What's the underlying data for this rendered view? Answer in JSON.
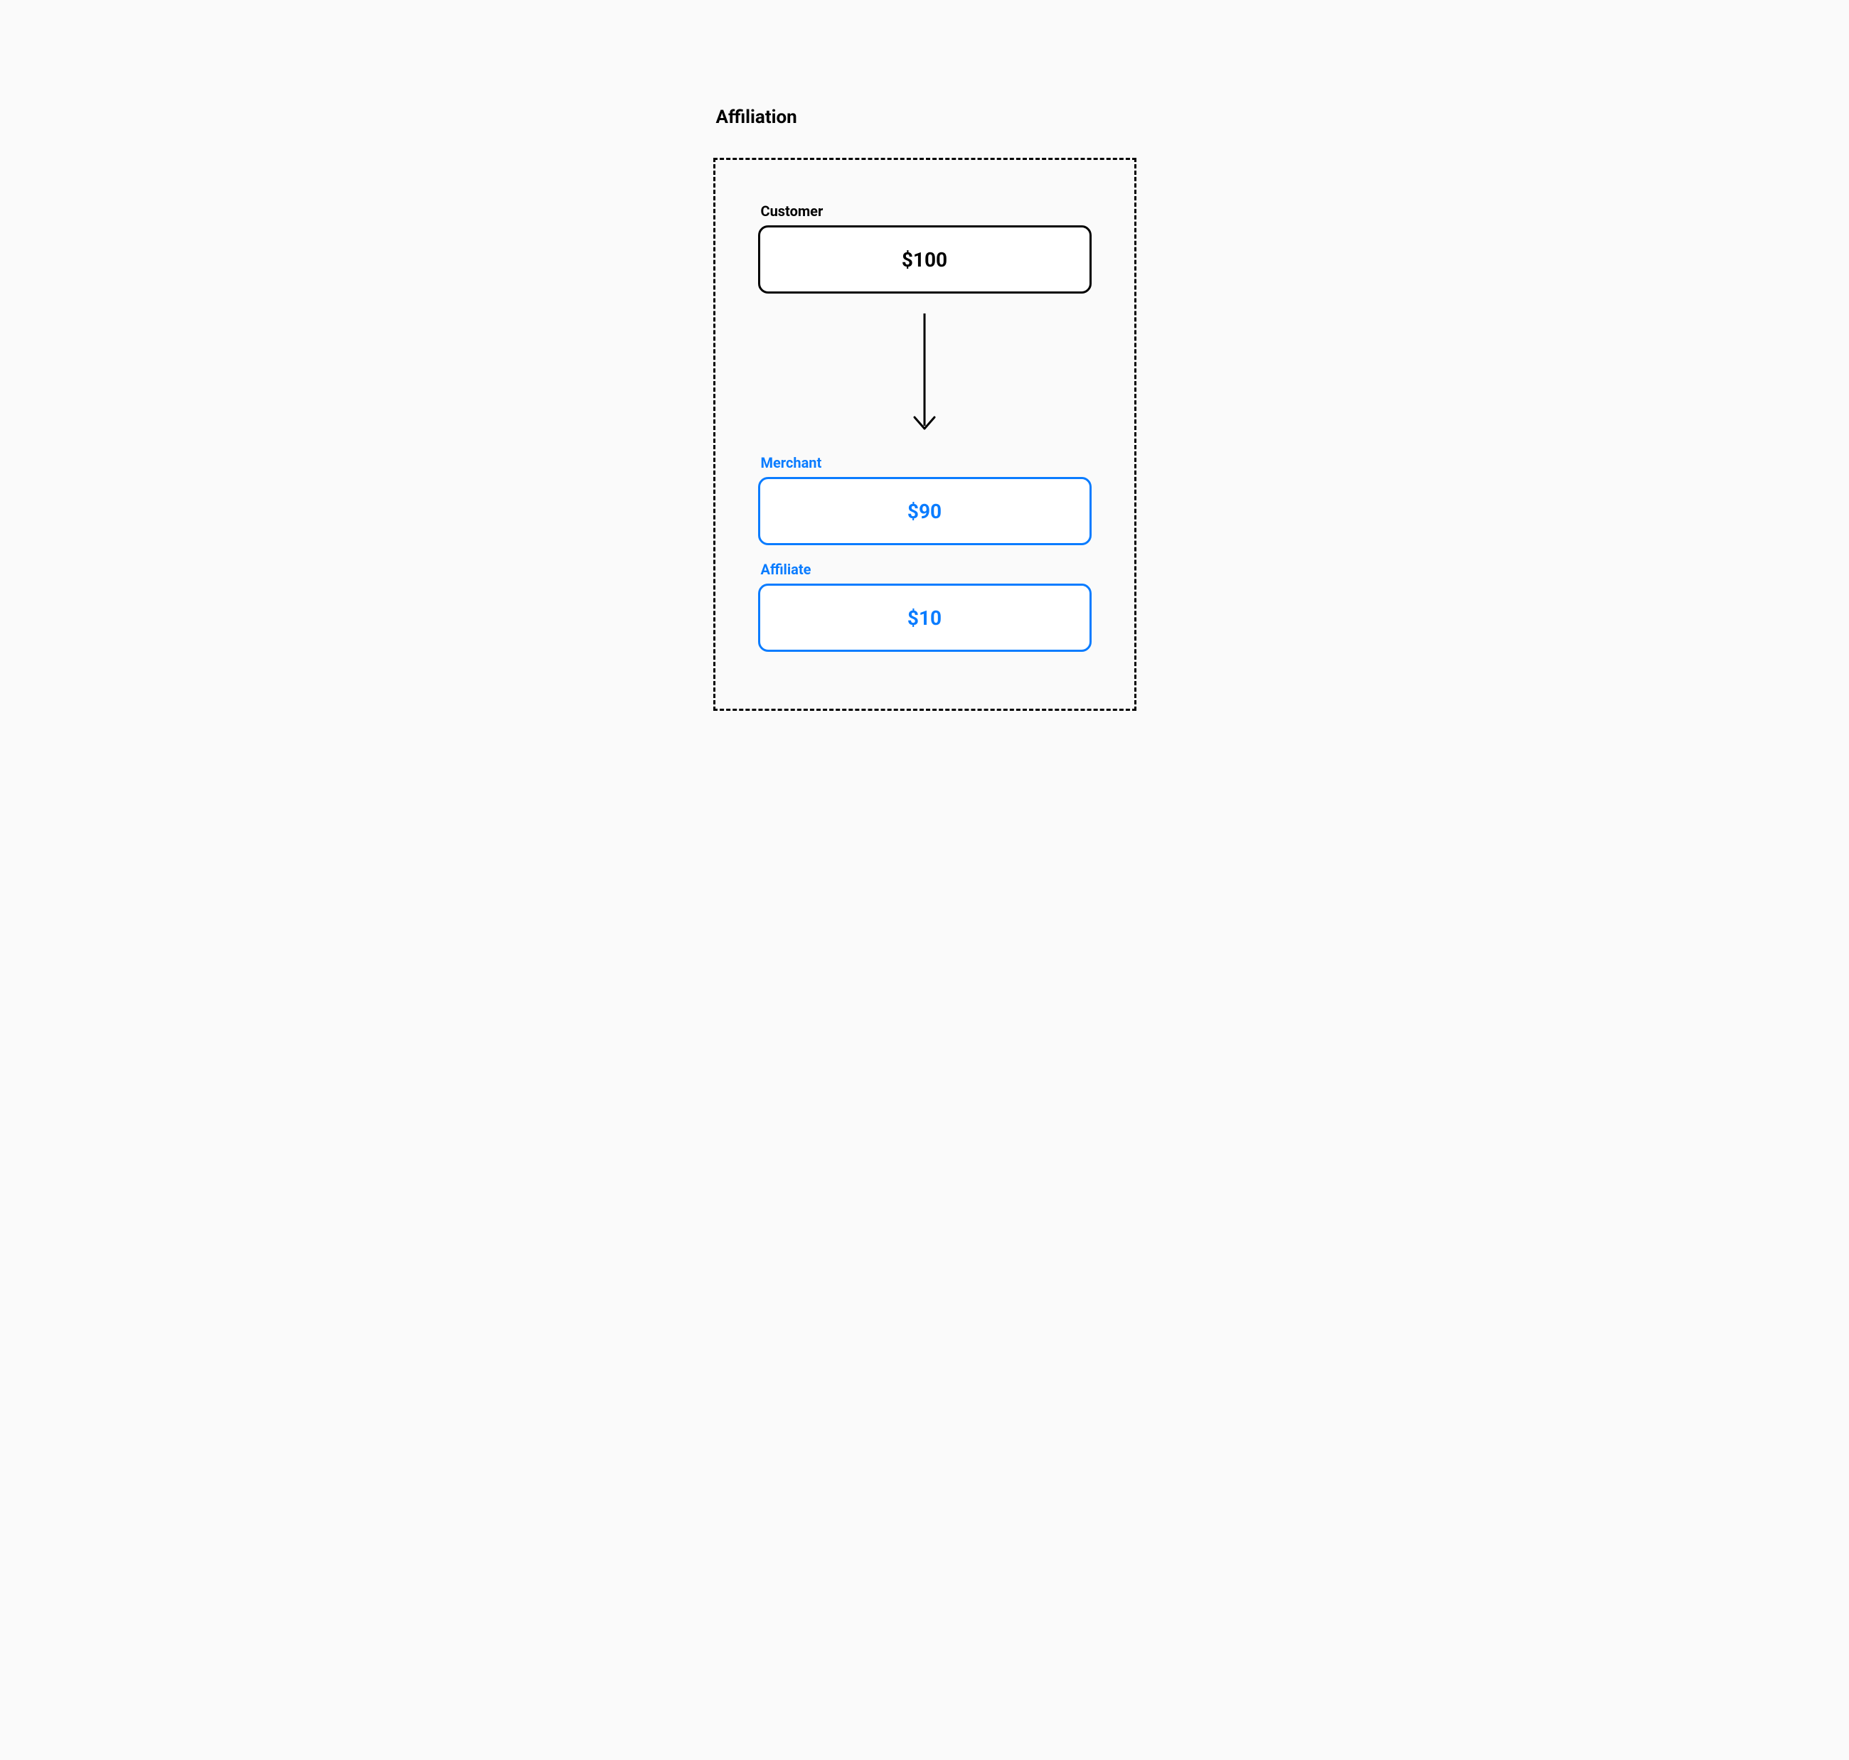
{
  "title": "Affiliation",
  "customer": {
    "label": "Customer",
    "amount": "$100"
  },
  "merchant": {
    "label": "Merchant",
    "amount": "$90"
  },
  "affiliate": {
    "label": "Affiliate",
    "amount": "$10"
  },
  "colors": {
    "accent_blue": "#0a7cff",
    "black": "#000000",
    "bg": "#fafafa"
  }
}
